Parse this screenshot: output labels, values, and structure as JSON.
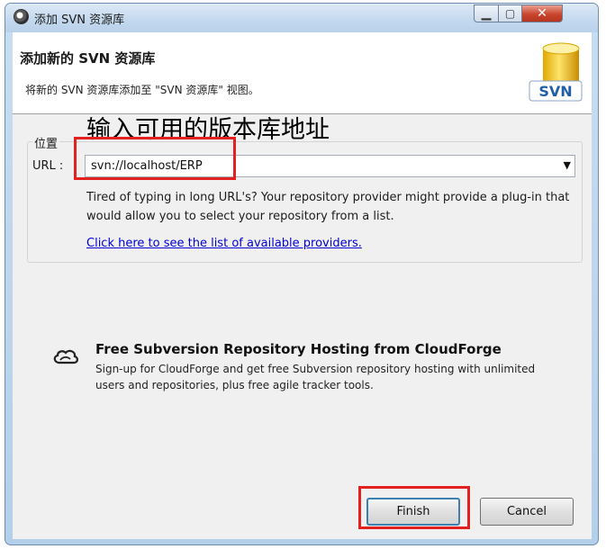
{
  "window": {
    "title": "添加 SVN 资源库",
    "controls": {
      "minimize": "▁",
      "maximize": "▢",
      "close": "✕"
    }
  },
  "header": {
    "title": "添加新的 SVN 资源库",
    "description": "将新的 SVN 资源库添加至 \"SVN 资源库\" 视图。",
    "logo_text": "SVN",
    "logo_icon": "svn-database-icon"
  },
  "annotation": {
    "text": "输入可用的版本库地址",
    "highlight_color": "#e32121"
  },
  "location_group": {
    "legend": "位置",
    "url_label": "URL :",
    "url_value": "svn://localhost/ERP",
    "dropdown_icon": "chevron-down-icon",
    "hint": "Tired of typing in long URL's?  Your repository provider might provide a plug-in that would allow you to select your repository from a list.",
    "providers_link": "Click here to see the list of available providers."
  },
  "cloudforge": {
    "icon": "cloud-icon",
    "title": "Free Subversion Repository Hosting from CloudForge",
    "description": "Sign-up for CloudForge and get free Subversion repository hosting with unlimited users and repositories, plus free agile tracker tools."
  },
  "buttons": {
    "finish": "Finish",
    "cancel": "Cancel"
  },
  "colors": {
    "link": "#0000d8",
    "title_bar": "#c3d8ee",
    "close_button": "#c9452d"
  }
}
